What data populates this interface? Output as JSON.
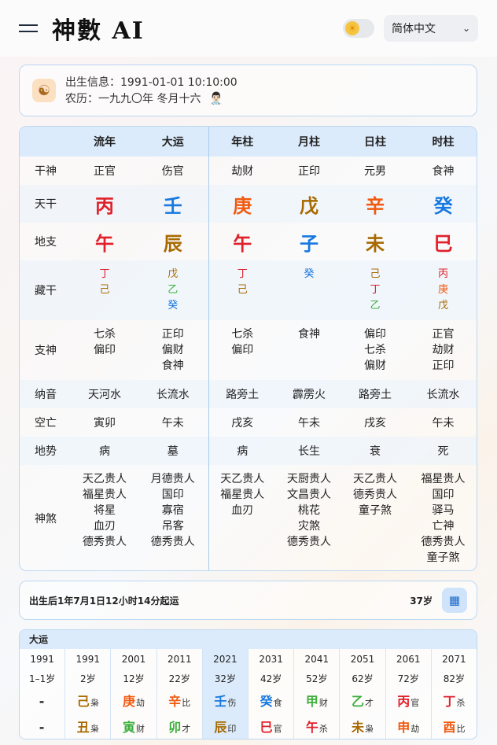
{
  "header": {
    "app_title": "神數 AI",
    "language": "简体中文",
    "theme_icon": "sun-icon"
  },
  "birth": {
    "solar": "出生信息：1991-01-01 10:10:00",
    "lunar": "农历：一九九〇年 冬月十六",
    "avatar_emoji": "👨🏻‍⚕️"
  },
  "table": {
    "headers": [
      "流年",
      "大运",
      "年柱",
      "月柱",
      "日柱",
      "时柱"
    ],
    "row_labels": {
      "shishen": "干神",
      "tiangan": "天干",
      "dizhi": "地支",
      "canggan": "藏干",
      "fushen": "支神",
      "nayin": "纳音",
      "kongwang": "空亡",
      "dishi": "地势",
      "shensha": "神煞"
    },
    "shishen": [
      "正官",
      "伤官",
      "劫财",
      "正印",
      "元男",
      "食神"
    ],
    "tiangan": [
      "丙",
      "壬",
      "庚",
      "戊",
      "辛",
      "癸"
    ],
    "tiangan_colors": [
      "red",
      "blue",
      "orange",
      "brown",
      "orange",
      "blue"
    ],
    "dizhi": [
      "午",
      "辰",
      "午",
      "子",
      "未",
      "巳"
    ],
    "dizhi_colors": [
      "red",
      "brown",
      "red",
      "blue",
      "brown",
      "red"
    ],
    "canggan": [
      [
        {
          "t": "丁",
          "c": "red"
        },
        {
          "t": "己",
          "c": "brown"
        }
      ],
      [
        {
          "t": "戊",
          "c": "brown"
        },
        {
          "t": "乙",
          "c": "green"
        },
        {
          "t": "癸",
          "c": "blue"
        }
      ],
      [
        {
          "t": "丁",
          "c": "red"
        },
        {
          "t": "己",
          "c": "brown"
        }
      ],
      [
        {
          "t": "癸",
          "c": "blue"
        }
      ],
      [
        {
          "t": "己",
          "c": "brown"
        },
        {
          "t": "丁",
          "c": "red"
        },
        {
          "t": "乙",
          "c": "green"
        }
      ],
      [
        {
          "t": "丙",
          "c": "red"
        },
        {
          "t": "庚",
          "c": "orange"
        },
        {
          "t": "戊",
          "c": "brown"
        }
      ]
    ],
    "fushen": [
      [
        "七杀",
        "偏印"
      ],
      [
        "正印",
        "偏财",
        "食神"
      ],
      [
        "七杀",
        "偏印"
      ],
      [
        "食神"
      ],
      [
        "偏印",
        "七杀",
        "偏财"
      ],
      [
        "正官",
        "劫财",
        "正印"
      ]
    ],
    "nayin": [
      "天河水",
      "长流水",
      "路旁土",
      "霹雳火",
      "路旁土",
      "长流水"
    ],
    "kongwang": [
      "寅卯",
      "午未",
      "戌亥",
      "午未",
      "戌亥",
      "午未"
    ],
    "dishi": [
      "病",
      "墓",
      "病",
      "长生",
      "衰",
      "死"
    ],
    "shensha": [
      [
        "天乙贵人",
        "福星贵人",
        "将星",
        "血刃",
        "德秀贵人"
      ],
      [
        "月德贵人",
        "国印",
        "寡宿",
        "吊客",
        "德秀贵人"
      ],
      [
        "天乙贵人",
        "福星贵人",
        "血刃"
      ],
      [
        "天厨贵人",
        "文昌贵人",
        "桃花",
        "灾煞",
        "德秀贵人"
      ],
      [
        "天乙贵人",
        "德秀贵人",
        "童子煞"
      ],
      [
        "福星贵人",
        "国印",
        "驿马",
        "亡神",
        "德秀贵人",
        "童子煞"
      ]
    ]
  },
  "qiyun": {
    "text": "出生后1年7月1日12小时14分起运",
    "age": "37岁",
    "icon": "calendar-icon"
  },
  "dayun": {
    "title": "大运",
    "selected_index": 4,
    "items": [
      {
        "year": "1991",
        "age": "1–1岁",
        "gan": "-",
        "gan_god": "",
        "gan_c": "",
        "zhi": "-",
        "zhi_god": "",
        "zhi_c": ""
      },
      {
        "year": "1991",
        "age": "2岁",
        "gan": "己",
        "gan_god": "枭",
        "gan_c": "brown",
        "zhi": "丑",
        "zhi_god": "枭",
        "zhi_c": "brown"
      },
      {
        "year": "2001",
        "age": "12岁",
        "gan": "庚",
        "gan_god": "劫",
        "gan_c": "orange",
        "zhi": "寅",
        "zhi_god": "财",
        "zhi_c": "green"
      },
      {
        "year": "2011",
        "age": "22岁",
        "gan": "辛",
        "gan_god": "比",
        "gan_c": "orange",
        "zhi": "卯",
        "zhi_god": "才",
        "zhi_c": "green"
      },
      {
        "year": "2021",
        "age": "32岁",
        "gan": "壬",
        "gan_god": "伤",
        "gan_c": "blue",
        "zhi": "辰",
        "zhi_god": "印",
        "zhi_c": "brown"
      },
      {
        "year": "2031",
        "age": "42岁",
        "gan": "癸",
        "gan_god": "食",
        "gan_c": "blue",
        "zhi": "巳",
        "zhi_god": "官",
        "zhi_c": "red"
      },
      {
        "year": "2041",
        "age": "52岁",
        "gan": "甲",
        "gan_god": "财",
        "gan_c": "green",
        "zhi": "午",
        "zhi_god": "杀",
        "zhi_c": "red"
      },
      {
        "year": "2051",
        "age": "62岁",
        "gan": "乙",
        "gan_god": "才",
        "gan_c": "green",
        "zhi": "未",
        "zhi_god": "枭",
        "zhi_c": "brown"
      },
      {
        "year": "2061",
        "age": "72岁",
        "gan": "丙",
        "gan_god": "官",
        "gan_c": "red",
        "zhi": "申",
        "zhi_god": "劫",
        "zhi_c": "orange"
      },
      {
        "year": "2071",
        "age": "82岁",
        "gan": "丁",
        "gan_god": "杀",
        "gan_c": "red",
        "zhi": "酉",
        "zhi_god": "比",
        "zhi_c": "orange"
      }
    ]
  }
}
